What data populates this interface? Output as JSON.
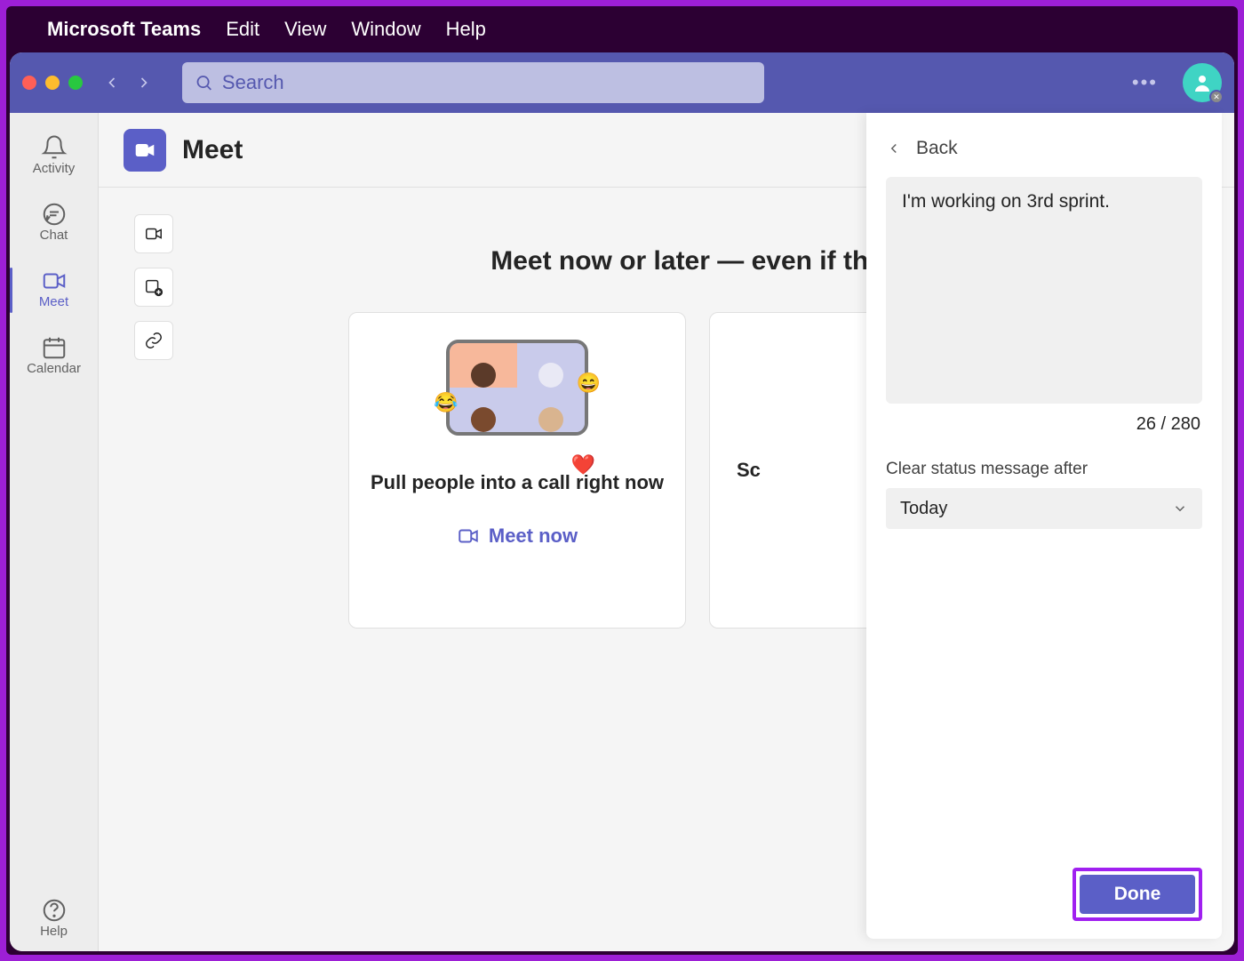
{
  "menubar": {
    "app": "Microsoft Teams",
    "items": [
      "Edit",
      "View",
      "Window",
      "Help"
    ]
  },
  "titlebar": {
    "search_placeholder": "Search"
  },
  "rail": {
    "items": [
      {
        "label": "Activity"
      },
      {
        "label": "Chat"
      },
      {
        "label": "Meet"
      },
      {
        "label": "Calendar"
      }
    ],
    "help": "Help"
  },
  "page": {
    "title": "Meet",
    "hero": "Meet now or later — even if they'",
    "card1": {
      "title": "Pull people into a call right now",
      "action": "Meet now"
    },
    "card2": {
      "partial": "Sc"
    }
  },
  "panel": {
    "back": "Back",
    "status_value": "I'm working on 3rd sprint.",
    "counter": "26 / 280",
    "clear_label": "Clear status message after",
    "clear_value": "Today",
    "done": "Done"
  }
}
